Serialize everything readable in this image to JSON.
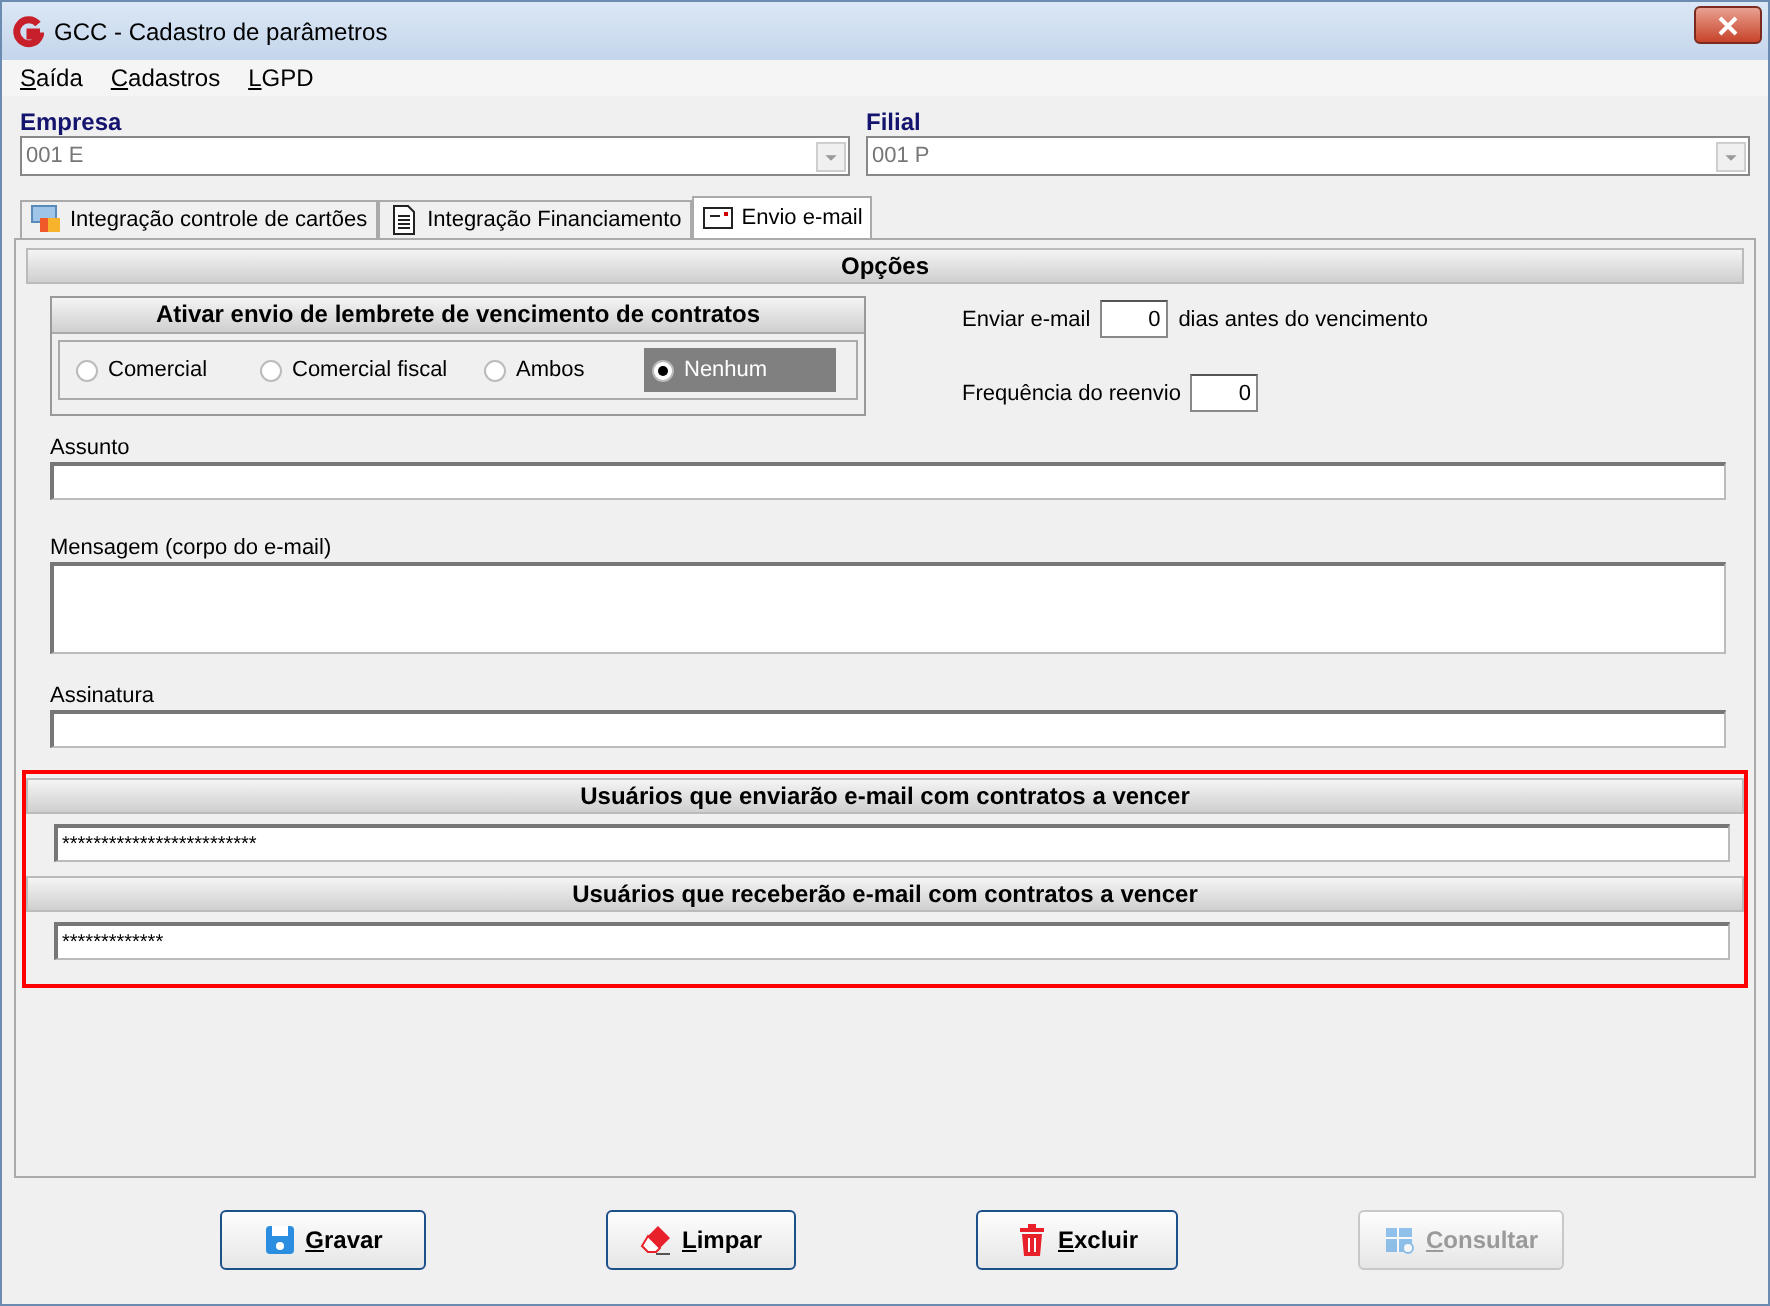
{
  "window": {
    "title": "GCC - Cadastro de parâmetros"
  },
  "menu": [
    {
      "label": "Saída"
    },
    {
      "label": "Cadastros"
    },
    {
      "label": "LGPD"
    }
  ],
  "selectors": [
    {
      "label": "Empresa",
      "value": "001 E"
    },
    {
      "label": "Filial",
      "value": "001 P"
    }
  ],
  "tabs": [
    {
      "label": "Integração controle de cartões",
      "selected": false
    },
    {
      "label": "Integração Financiamento",
      "selected": false
    },
    {
      "label": "Envio e-mail",
      "selected": true
    }
  ],
  "options": {
    "title": "Opções",
    "reminder": {
      "title": "Ativar envio de lembrete de vencimento de contratos",
      "choices": [
        {
          "label": "Comercial",
          "selected": false
        },
        {
          "label": "Comercial fiscal",
          "selected": false
        },
        {
          "label": "Ambos",
          "selected": false
        },
        {
          "label": "Nenhum",
          "selected": true
        }
      ]
    },
    "send_days": {
      "label": "Enviar e-mail",
      "value": "0",
      "suffix": "dias antes do vencimento"
    },
    "resend": {
      "label": "Frequência do reenvio",
      "value": "0"
    },
    "subject": {
      "label": "Assunto"
    },
    "message": {
      "label": "Mensagem (corpo do e-mail)"
    },
    "signature": {
      "label": "Assinatura"
    }
  },
  "users": {
    "highlighted": true,
    "sections": [
      {
        "title": "Usuários que enviarão e-mail com contratos a vencer",
        "value": "*************************"
      },
      {
        "title": "Usuários que receberão e-mail com contratos a vencer",
        "value": "*************"
      }
    ]
  },
  "buttons": [
    {
      "label": "Gravar",
      "disabled": false
    },
    {
      "label": "Limpar",
      "disabled": false
    },
    {
      "label": "Excluir",
      "disabled": false
    },
    {
      "label": "Consultar",
      "disabled": true
    }
  ]
}
